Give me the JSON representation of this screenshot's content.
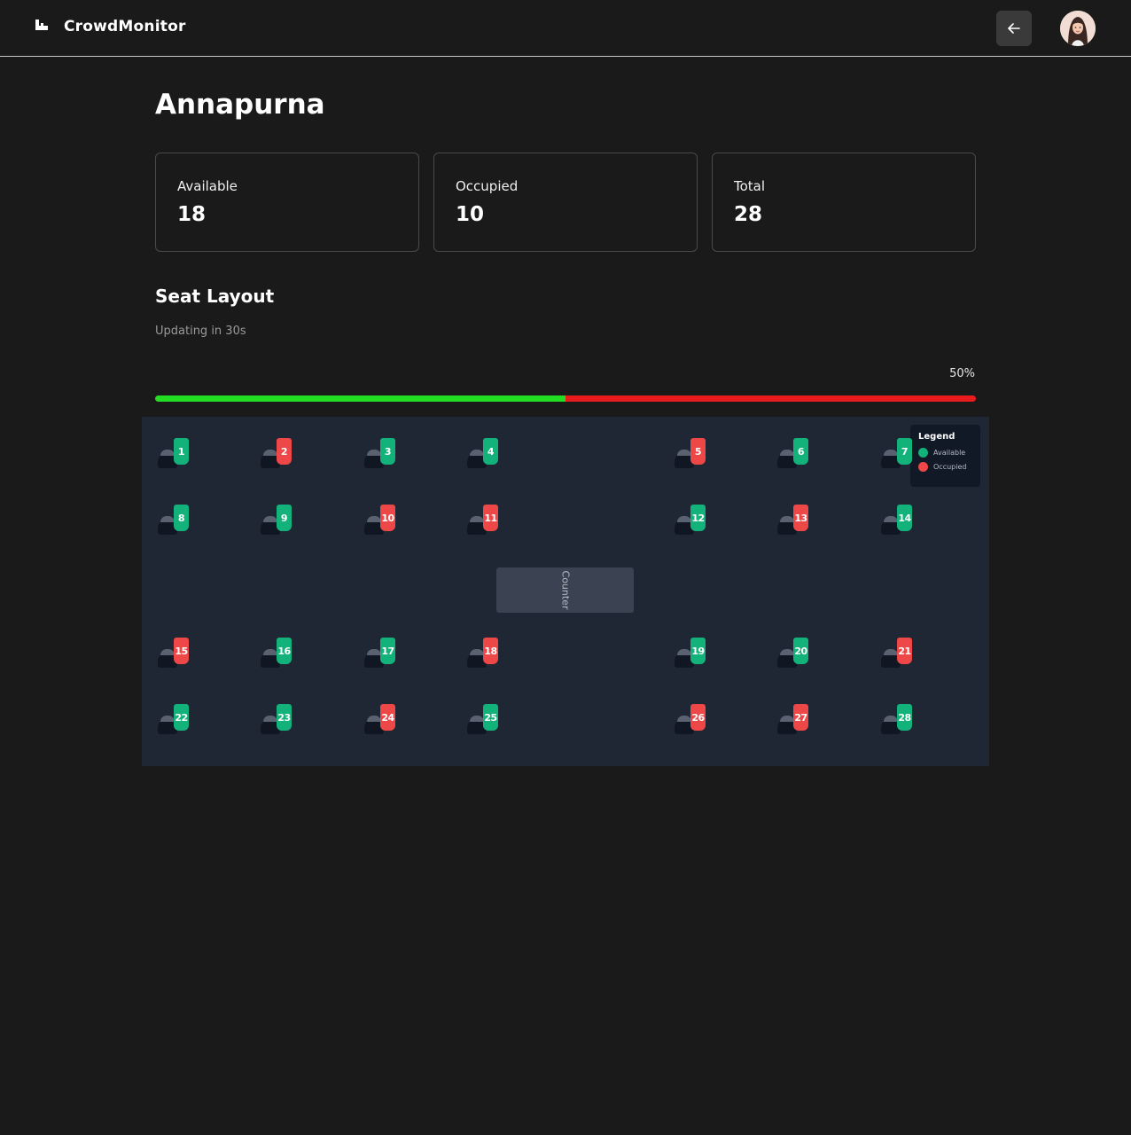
{
  "app": {
    "name": "CrowdMonitor",
    "logo_icon": "brand-logo-icon"
  },
  "header": {
    "back_icon": "arrow-left-icon",
    "avatar_icon": "user-avatar-icon"
  },
  "page": {
    "title": "Annapurna"
  },
  "stats": [
    {
      "label": "Available",
      "value": "18"
    },
    {
      "label": "Occupied",
      "value": "10"
    },
    {
      "label": "Total",
      "value": "28"
    }
  ],
  "seat_layout": {
    "title": "Seat Layout",
    "update_text": "Updating in 30s",
    "percent_label": "50%",
    "occupancy_fraction": 0.5,
    "counter_label": "Counter",
    "legend": {
      "title": "Legend",
      "items": [
        {
          "label": "Available",
          "color": "#13b27a"
        },
        {
          "label": "Occupied",
          "color": "#ee4747"
        }
      ]
    },
    "seats": [
      {
        "number": "1",
        "status": "available"
      },
      {
        "number": "2",
        "status": "occupied"
      },
      {
        "number": "3",
        "status": "available"
      },
      {
        "number": "4",
        "status": "available"
      },
      {
        "number": "5",
        "status": "occupied"
      },
      {
        "number": "6",
        "status": "available"
      },
      {
        "number": "7",
        "status": "available"
      },
      {
        "number": "8",
        "status": "available"
      },
      {
        "number": "9",
        "status": "available"
      },
      {
        "number": "10",
        "status": "occupied"
      },
      {
        "number": "11",
        "status": "occupied"
      },
      {
        "number": "12",
        "status": "available"
      },
      {
        "number": "13",
        "status": "occupied"
      },
      {
        "number": "14",
        "status": "available"
      },
      {
        "number": "15",
        "status": "occupied"
      },
      {
        "number": "16",
        "status": "available"
      },
      {
        "number": "17",
        "status": "available"
      },
      {
        "number": "18",
        "status": "occupied"
      },
      {
        "number": "19",
        "status": "available"
      },
      {
        "number": "20",
        "status": "available"
      },
      {
        "number": "21",
        "status": "occupied"
      },
      {
        "number": "22",
        "status": "available"
      },
      {
        "number": "23",
        "status": "available"
      },
      {
        "number": "24",
        "status": "occupied"
      },
      {
        "number": "25",
        "status": "available"
      },
      {
        "number": "26",
        "status": "occupied"
      },
      {
        "number": "27",
        "status": "occupied"
      },
      {
        "number": "28",
        "status": "available"
      }
    ]
  },
  "colors": {
    "available": "#13b27a",
    "occupied": "#ee4747",
    "bar_available": "#22dd22",
    "bar_occupied": "#e81c1c"
  }
}
